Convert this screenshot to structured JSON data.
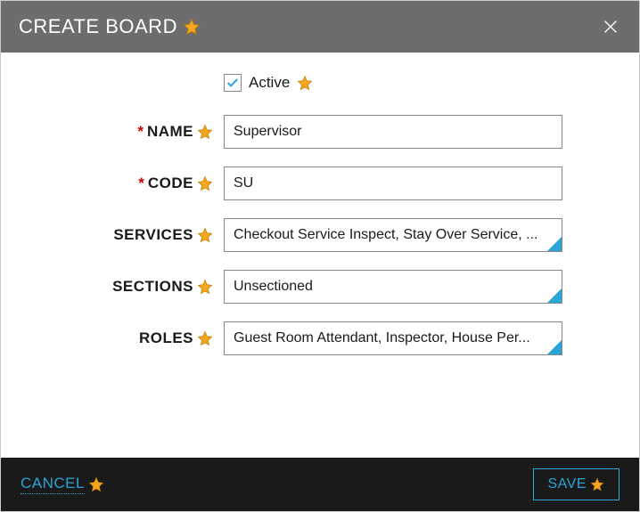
{
  "header": {
    "title": "CREATE BOARD"
  },
  "form": {
    "active": {
      "label": "Active",
      "checked": true
    },
    "name": {
      "label": "NAME",
      "required": true,
      "value": "Supervisor"
    },
    "code": {
      "label": "CODE",
      "required": true,
      "value": "SU"
    },
    "services": {
      "label": "SERVICES",
      "required": false,
      "value": "Checkout Service Inspect, Stay Over Service, ..."
    },
    "sections": {
      "label": "SECTIONS",
      "required": false,
      "value": "Unsectioned"
    },
    "roles": {
      "label": "ROLES",
      "required": false,
      "value": "Guest Room Attendant, Inspector, House Per..."
    }
  },
  "footer": {
    "cancel_label": "CANCEL",
    "save_label": "SAVE"
  },
  "colors": {
    "header_bg": "#6d6d6d",
    "footer_bg": "#1a1a1a",
    "accent": "#2ba4d8",
    "star": "#f5a623",
    "required": "#d00000"
  }
}
